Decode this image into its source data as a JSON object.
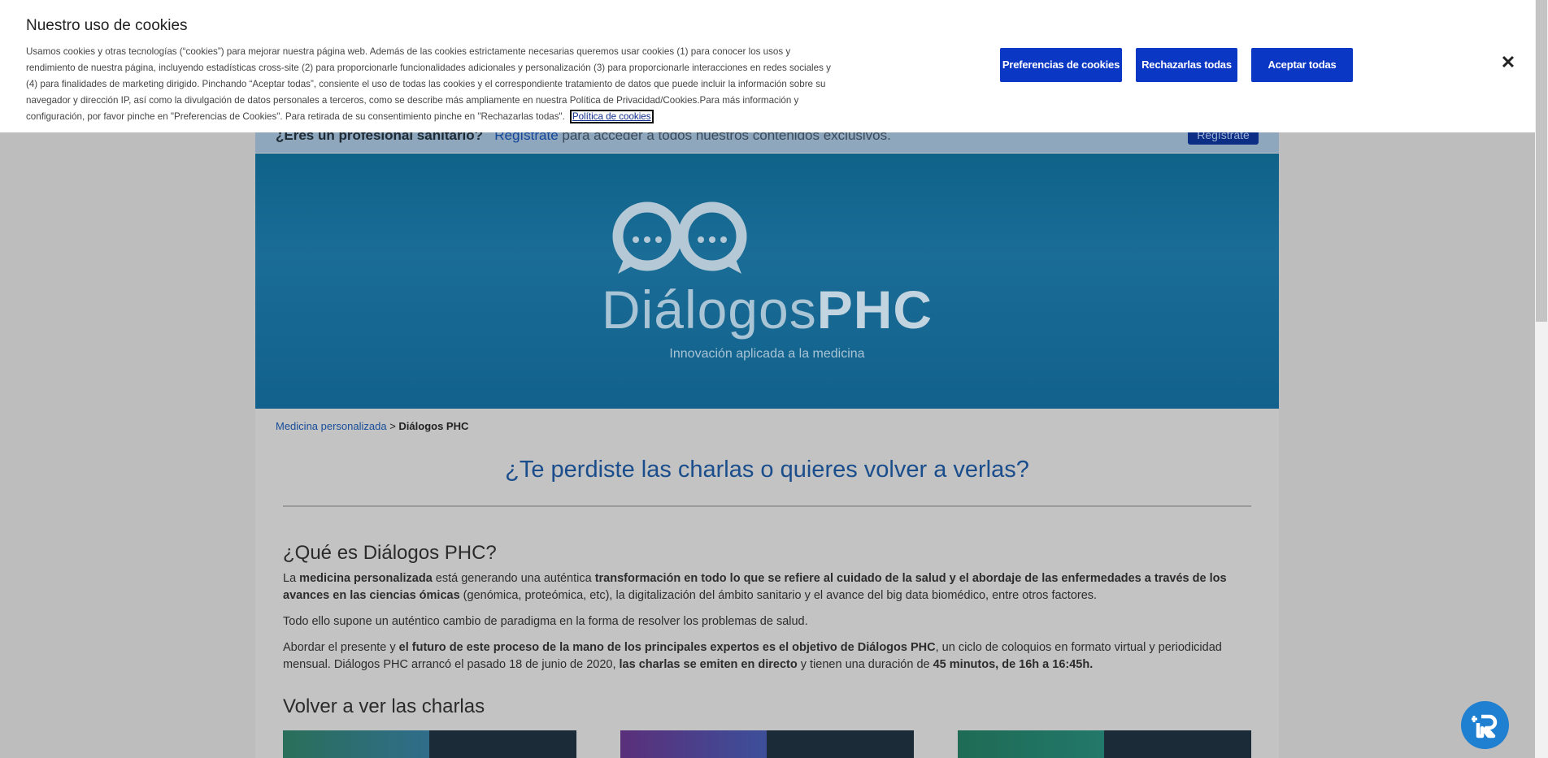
{
  "pro_bar": {
    "question": "¿Eres un profesional sanitario?",
    "link": "Regístrate",
    "rest": " para acceder a todos nuestros contenidos exclusivos.",
    "button": "Regístrate"
  },
  "hero": {
    "logo_light": "Diálogos",
    "logo_bold": "PHC",
    "tagline": "Innovación aplicada a la medicina"
  },
  "breadcrumb": {
    "link": "Medicina personalizada",
    "separator": " > ",
    "current": "Diálogos PHC"
  },
  "headline": "¿Te perdiste las charlas o quieres volver a verlas?",
  "about": {
    "title": "¿Qué es Diálogos PHC?",
    "p1": [
      {
        "t": "La ",
        "b": false
      },
      {
        "t": "medicina personalizada",
        "b": true
      },
      {
        "t": " está generando una auténtica ",
        "b": false
      },
      {
        "t": "transformación en todo lo que se refiere al cuidado de la salud y el abordaje de las enfermedades a través de los avances en las ciencias ómicas",
        "b": true
      },
      {
        "t": " (genómica, proteómica, etc), la digitalización del ámbito sanitario y el avance del big data biomédico, entre otros factores.",
        "b": false
      }
    ],
    "p2": "Todo ello supone un auténtico cambio de paradigma en la forma de resolver los problemas de salud.",
    "p3": [
      {
        "t": "Abordar el presente y ",
        "b": false
      },
      {
        "t": "el futuro de este proceso de la mano de los principales expertos es el objetivo de Diálogos PHC",
        "b": true
      },
      {
        "t": ", un ciclo de coloquios en formato virtual y periodicidad mensual. Diálogos PHC arrancó el pasado 18 de junio de 2020, ",
        "b": false
      },
      {
        "t": "las charlas se emiten en directo",
        "b": true
      },
      {
        "t": " y tienen una duración de ",
        "b": false
      },
      {
        "t": "45 minutos, de 16h a 16:45h.",
        "b": true
      }
    ]
  },
  "replays_title": "Volver a ver las charlas",
  "cookie_banner": {
    "title": "Nuestro uso de cookies",
    "body": "Usamos cookies y otras tecnologías (“cookies”) para mejorar nuestra página web. Además de las cookies estrictamente necesarias queremos usar cookies (1) para conocer los usos y rendimiento de nuestra página, incluyendo estadísticas cross-site (2) para proporcionarle funcionalidades adicionales y personalización (3) para proporcionarle interacciones en redes sociales y (4) para finalidades de marketing dirigido. Pinchando “Aceptar todas”, consiente el uso de todas las cookies y el correspondiente tratamiento de datos que puede incluir la información sobre su navegador y dirección IP, así como la divulgación de datos personales a terceros, como se describe más ampliamente en nuestra Política de Privacidad/Cookies.Para más información y configuración, por favor pinche en \"Preferencias de Cookies\". Para retirada de su consentimiento pinche en \"Rechazarlas todas\".",
    "policy_link": "Política de cookies",
    "btn_prefs": "Preferencias de cookies",
    "btn_reject": "Rechazarlas todas",
    "btn_accept": "Aceptar todas",
    "close_icon": "close-icon"
  },
  "colors": {
    "primary_button": "#0b37c5",
    "headline": "#1a4d8c",
    "fab": "#1f7fd0"
  }
}
